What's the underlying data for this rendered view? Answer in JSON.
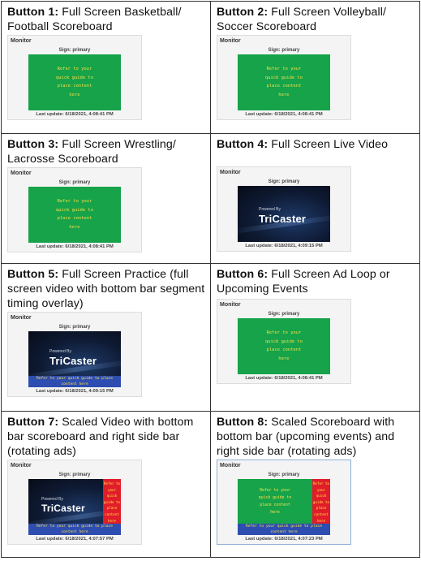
{
  "cells": [
    {
      "button": "Button 1:",
      "desc": "Full Screen Basketball/ Football Scoreboard"
    },
    {
      "button": "Button 2:",
      "desc": "Full Screen Volleyball/ Soccer Scoreboard"
    },
    {
      "button": "Button 3:",
      "desc": "Full Screen Wrestling/ Lacrosse Scoreboard"
    },
    {
      "button": "Button 4:",
      "desc": "Full Screen Live Video"
    },
    {
      "button": "Button 5:",
      "desc": "Full Screen Practice (full screen video with bottom bar segment timing overlay)"
    },
    {
      "button": "Button 6:",
      "desc": "Full Screen Ad Loop or Upcoming Events"
    },
    {
      "button": "Button 7:",
      "desc": "Scaled Video with bottom bar scoreboard and right side bar (rotating ads)"
    },
    {
      "button": "Button 8:",
      "desc": "Scaled Scoreboard with bottom bar (upcoming events) and right side bar (rotating ads)"
    }
  ],
  "monitor": {
    "title": "Monitor",
    "sign": "Sign: primary",
    "green_lines": [
      "Refer to your",
      "quick guide to",
      "place content",
      "here"
    ],
    "powered_by": "Powered By",
    "tricaster": "TriCaster",
    "bottom_bar_lines": [
      "Refer to your quick guide to place",
      "content here"
    ],
    "side_bar_lines": [
      "Refer to",
      "your",
      "quick",
      "guide to",
      "place",
      "content",
      "here"
    ],
    "updates": [
      "Last update: 6/18/2021, 4:08:41 PM",
      "Last update: 6/18/2021, 4:08:41 PM",
      "Last update: 6/18/2021, 4:08:41 PM",
      "Last update: 6/18/2021, 4:09:15 PM",
      "Last update: 6/18/2021, 4:09:15 PM",
      "Last update: 6/18/2021, 4:08:41 PM",
      "Last update: 6/18/2021, 4:07:57 PM",
      "Last update: 6/18/2021, 4:07:23 PM"
    ]
  },
  "colors": {
    "screen_green": "#16a34a",
    "content_text_yellow": "#fde047",
    "bottom_bar_blue": "#2d4db0",
    "side_bar_red": "#e11d2a"
  }
}
